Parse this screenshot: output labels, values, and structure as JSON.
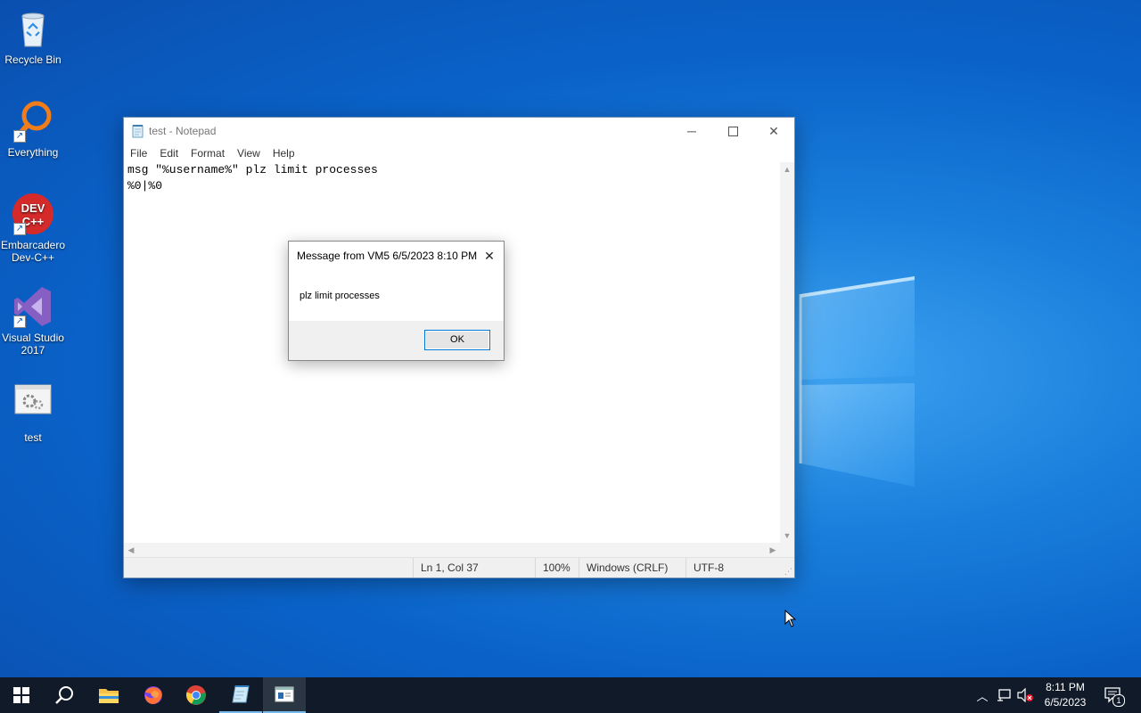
{
  "desktop": {
    "icons": [
      {
        "label": "Recycle Bin",
        "icon": "recycle-bin-icon"
      },
      {
        "label": "Everything",
        "icon": "everything-search-icon"
      },
      {
        "label": "Embarcadero Dev-C++",
        "icon": "devcpp-icon",
        "glyph": "DEV C++"
      },
      {
        "label": "Visual Studio 2017",
        "icon": "visual-studio-icon"
      },
      {
        "label": "test",
        "icon": "batch-file-icon"
      }
    ]
  },
  "notepad": {
    "title": "test - Notepad",
    "menu": [
      "File",
      "Edit",
      "Format",
      "View",
      "Help"
    ],
    "content": "msg \"%username%\" plz limit processes\n%0|%0",
    "status": {
      "position": "Ln 1, Col 37",
      "zoom": "100%",
      "line_ending": "Windows (CRLF)",
      "encoding": "UTF-8"
    }
  },
  "message_box": {
    "title": "Message from VM5 6/5/2023 8:10 PM",
    "text": "plz limit processes",
    "ok_label": "OK"
  },
  "taskbar": {
    "pinned": [
      {
        "name": "start-button",
        "icon": "windows-logo-icon"
      },
      {
        "name": "search-button",
        "icon": "search-icon"
      },
      {
        "name": "file-explorer",
        "icon": "folder-icon"
      },
      {
        "name": "firefox",
        "icon": "firefox-icon"
      },
      {
        "name": "chrome",
        "icon": "chrome-icon"
      },
      {
        "name": "notepad",
        "icon": "notepad-icon"
      },
      {
        "name": "message-window",
        "icon": "message-window-icon"
      }
    ],
    "clock": {
      "time": "8:11 PM",
      "date": "6/5/2023"
    },
    "notification_count": "1"
  },
  "colors": {
    "desktop_blue": "#0a63c9",
    "taskbar": "#101a29",
    "accent": "#0078d7"
  }
}
